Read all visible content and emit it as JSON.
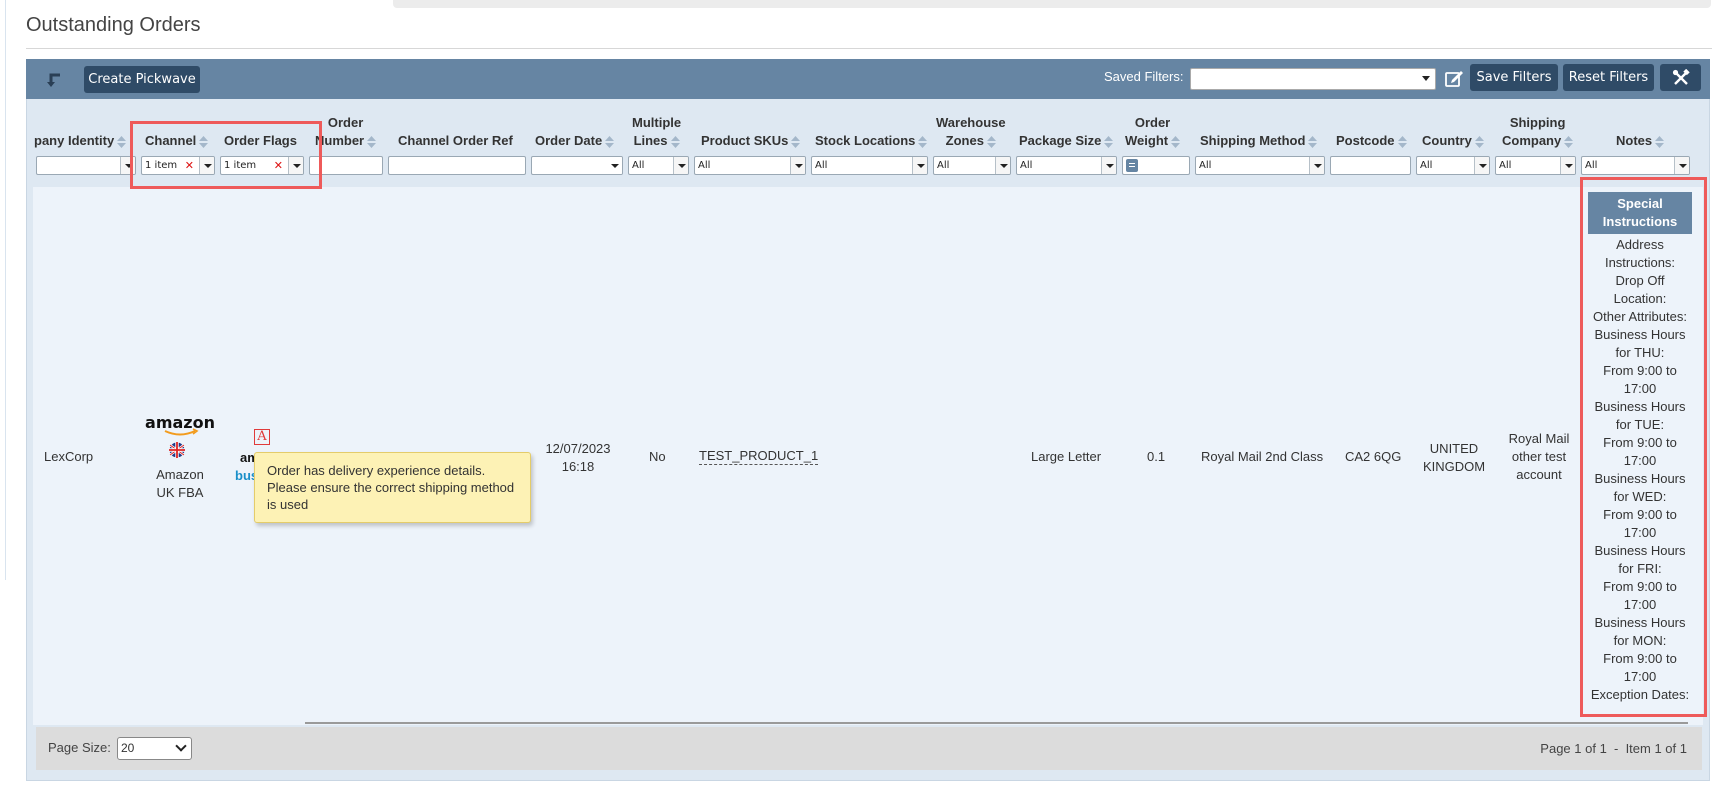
{
  "page": {
    "title": "Outstanding Orders"
  },
  "toolbar": {
    "create_pickwave_label": "Create Pickwave",
    "saved_filters_label": "Saved Filters:",
    "saved_filters_value": "",
    "save_filters_label": "Save Filters",
    "reset_filters_label": "Reset Filters",
    "tools_icon": "wrench-screwdriver-icon",
    "back_icon": "return-arrow-icon",
    "edit_icon": "edit-icon"
  },
  "columns": {
    "company_identity": "pany Identity",
    "channel": "Channel",
    "order_flags": "Order Flags",
    "order_number": [
      "Order",
      "Number"
    ],
    "channel_order_ref": "Channel Order Ref",
    "order_date": "Order Date",
    "multiple_lines": [
      "Multiple",
      "Lines"
    ],
    "product_skus": "Product SKUs",
    "stock_locations": "Stock Locations",
    "warehouse_zones": [
      "Warehouse",
      "Zones"
    ],
    "package_size": "Package Size",
    "order_weight": [
      "Order",
      "Weight"
    ],
    "shipping_method": "Shipping Method",
    "postcode": "Postcode",
    "country": "Country",
    "shipping_company": [
      "Shipping",
      "Company"
    ],
    "notes": "Notes"
  },
  "filters": {
    "channel": "1 item",
    "order_flags": "1 item",
    "multiple_lines": "All",
    "product_skus": "All",
    "stock_locations": "All",
    "warehouse_zones": "All",
    "package_size": "All",
    "shipping_method": "All",
    "country": "All",
    "shipping_company": "All",
    "notes": "All"
  },
  "row": {
    "company_identity": "LexCorp",
    "channel_logo": "amazon",
    "channel_flag": "uk-flag-icon",
    "channel_name": [
      "Amazon",
      "UK FBA"
    ],
    "order_flags_logo": [
      "am",
      "bus"
    ],
    "order_flag_badge": "A",
    "order_date": [
      "12/07/2023",
      "16:18"
    ],
    "multiple_lines": "No",
    "product_sku": "TEST_PRODUCT_1",
    "package_size": "Large Letter",
    "order_weight": "0.1",
    "shipping_method": "Royal Mail 2nd Class",
    "postcode": "CA2 6QG",
    "country": [
      "UNITED",
      "KINGDOM"
    ],
    "shipping_company": [
      "Royal Mail",
      "other test",
      "account"
    ],
    "notes_header": [
      "Special",
      "Instructions"
    ],
    "notes_lines": [
      "Address",
      "Instructions:",
      "Drop Off",
      "Location:",
      "Other Attributes:",
      "Business Hours",
      "for THU:",
      "From 9:00 to",
      "17:00",
      "Business Hours",
      "for TUE:",
      "From 9:00 to",
      "17:00",
      "Business Hours",
      "for WED:",
      "From 9:00 to",
      "17:00",
      "Business Hours",
      "for FRI:",
      "From 9:00 to",
      "17:00",
      "Business Hours",
      "for MON:",
      "From 9:00 to",
      "17:00",
      "Exception Dates:"
    ]
  },
  "tooltip": {
    "text": "Order has delivery experience details. Please ensure the correct shipping method is used"
  },
  "footer": {
    "page_size_label": "Page Size:",
    "page_size_value": "20",
    "pagination": "Page 1 of 1  -  Item 1 of 1"
  },
  "colors": {
    "toolbar": "#6685a3",
    "button": "#2f4b67",
    "highlight": "#ee5a5a",
    "tooltip": "#fdf2b5",
    "row_bg": "#edf3fa"
  }
}
